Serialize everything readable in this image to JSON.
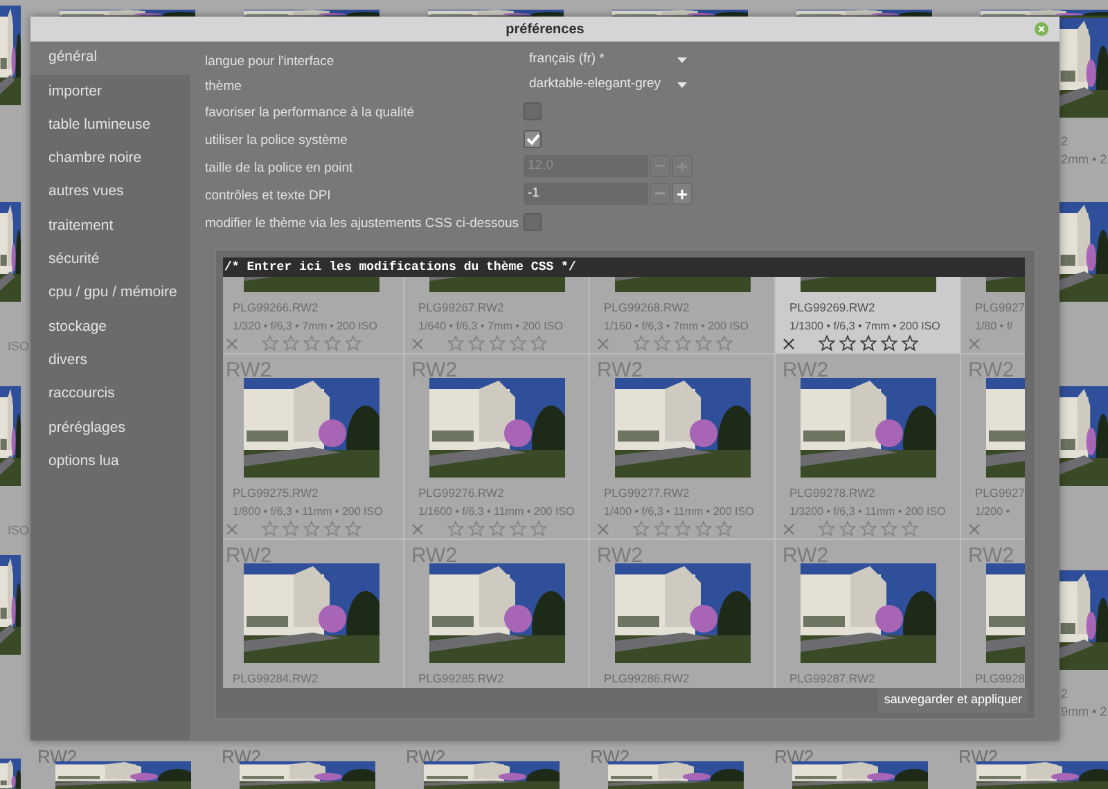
{
  "window": {
    "title": "préférences"
  },
  "sidebar": {
    "items": [
      {
        "label": "général",
        "selected": true
      },
      {
        "label": "importer",
        "selected": false
      },
      {
        "label": "table lumineuse",
        "selected": false
      },
      {
        "label": "chambre noire",
        "selected": false
      },
      {
        "label": "autres vues",
        "selected": false
      },
      {
        "label": "traitement",
        "selected": false
      },
      {
        "label": "sécurité",
        "selected": false
      },
      {
        "label": "cpu / gpu / mémoire",
        "selected": false
      },
      {
        "label": "stockage",
        "selected": false
      },
      {
        "label": "divers",
        "selected": false
      },
      {
        "label": "raccourcis",
        "selected": false
      },
      {
        "label": "préréglages",
        "selected": false
      },
      {
        "label": "options lua",
        "selected": false
      }
    ]
  },
  "settings": [
    {
      "kind": "dropdown",
      "label": "langue pour l'interface",
      "value": "français (fr) *"
    },
    {
      "kind": "dropdown",
      "label": "thème",
      "value": "darktable-elegant-grey"
    },
    {
      "kind": "checkbox",
      "label": "favoriser la performance à la qualité",
      "checked": false
    },
    {
      "kind": "checkbox",
      "label": "utiliser la police système",
      "checked": true
    },
    {
      "kind": "number",
      "label": "taille de la police en point",
      "value": "12,0",
      "disabled": true
    },
    {
      "kind": "number",
      "label": "contrôles et texte DPI",
      "value": "-1",
      "disabled": false
    },
    {
      "kind": "checkbox",
      "label": "modifier le thème via les ajustements CSS ci-dessous",
      "checked": false
    }
  ],
  "css_editor": {
    "text": "/* Entrer ici les modifications du thème CSS */",
    "thumbnails": [
      [
        {
          "filename": "PLG99266.RW2",
          "exif": "1/320 • f/6,3 • 7mm • 200 ISO",
          "stars": 0,
          "highlighted": false
        },
        {
          "filename": "PLG99267.RW2",
          "exif": "1/640 • f/6,3 • 7mm • 200 ISO",
          "stars": 0,
          "highlighted": false
        },
        {
          "filename": "PLG99268.RW2",
          "exif": "1/160 • f/6,3 • 7mm • 200 ISO",
          "stars": 0,
          "highlighted": false
        },
        {
          "filename": "PLG99269.RW2",
          "exif": "1/1300 • f/6,3 • 7mm • 200 ISO",
          "stars": 0,
          "highlighted": true
        },
        {
          "filename": "PLG9927",
          "exif": "1/80 • f/",
          "highlighted": false
        }
      ],
      [
        {
          "label": "RW2",
          "filename": "PLG99275.RW2",
          "exif": "1/800 • f/6,3 • 11mm • 200 ISO",
          "stars": 0,
          "highlighted": false
        },
        {
          "label": "RW2",
          "filename": "PLG99276.RW2",
          "exif": "1/1600 • f/6,3 • 11mm • 200 ISO",
          "stars": 0,
          "highlighted": false
        },
        {
          "label": "RW2",
          "filename": "PLG99277.RW2",
          "exif": "1/400 • f/6,3 • 11mm • 200 ISO",
          "stars": 0,
          "highlighted": false
        },
        {
          "label": "RW2",
          "filename": "PLG99278.RW2",
          "exif": "1/3200 • f/6,3 • 11mm • 200 ISO",
          "stars": 0,
          "highlighted": false
        },
        {
          "label": "RW2",
          "filename": "PLG9927",
          "exif": "1/200 •",
          "highlighted": false
        }
      ],
      [
        {
          "label": "RW2",
          "filename": "PLG99284.RW2",
          "highlighted": false
        },
        {
          "label": "RW2",
          "filename": "PLG99285.RW2",
          "highlighted": false
        },
        {
          "label": "RW2",
          "filename": "PLG99286.RW2",
          "highlighted": false
        },
        {
          "label": "RW2",
          "filename": "PLG99287.RW2",
          "highlighted": false
        },
        {
          "label": "RW2",
          "filename": "PLG9928",
          "highlighted": false
        }
      ]
    ],
    "button": "sauvegarder et appliquer"
  },
  "background": {
    "left_strip": [
      {
        "exif": "ISO"
      },
      {
        "exif": "ISO"
      }
    ],
    "right_strip": [
      {
        "filename": "2",
        "exif": "2mm • 2"
      },
      {
        "filename": "2",
        "exif": "9mm • 2"
      }
    ],
    "bottom_strip": [
      "RW2",
      "RW2",
      "RW2",
      "RW2",
      "RW2",
      "RW2"
    ]
  }
}
